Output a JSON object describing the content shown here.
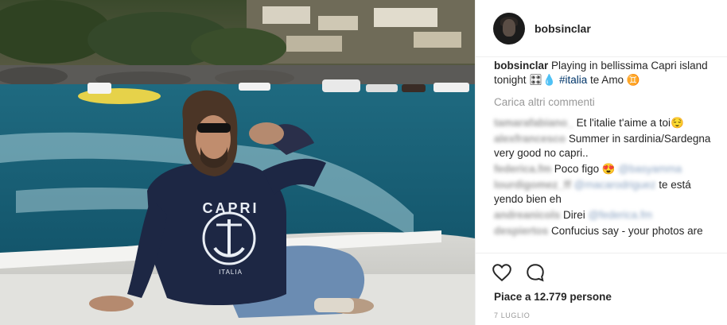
{
  "post": {
    "username": "bobsinclar",
    "caption": {
      "username": "bobsinclar",
      "text": "Playing in bellissima Capri island tonight 🎛💧",
      "hashtag": "#italia",
      "tail": "te Amo ♊"
    },
    "load_more": "Carica altri commenti",
    "comments": [
      {
        "user": "tamarafabiano_",
        "text": "Et l'italie t'aime a toi😌"
      },
      {
        "user": "alexfrancesco",
        "text": "Summer in sardinia/Sardegna very good no capri.."
      },
      {
        "user": "federica.fm",
        "text": "Poco figo 😍",
        "mention": "@basyamma"
      },
      {
        "user": "lourdigomez_ff",
        "text": "",
        "mention": "@macarodriguez",
        "tail": "te está yendo bien eh"
      },
      {
        "user": "andreanicols",
        "text": "Direi",
        "mention": "@federica.fm"
      },
      {
        "user": "despiertos",
        "text": "Confucius say - your photos are"
      }
    ],
    "likes": "Piace a 12.779 persone",
    "date": "7 LUGLIO"
  },
  "photo": {
    "sweater_text": "CAPRI",
    "sweater_sub": "ITALIA"
  },
  "icons": {
    "like": "heart-icon",
    "comment": "comment-icon"
  },
  "colors": {
    "link": "#003569",
    "muted": "#999999",
    "text": "#262626"
  }
}
